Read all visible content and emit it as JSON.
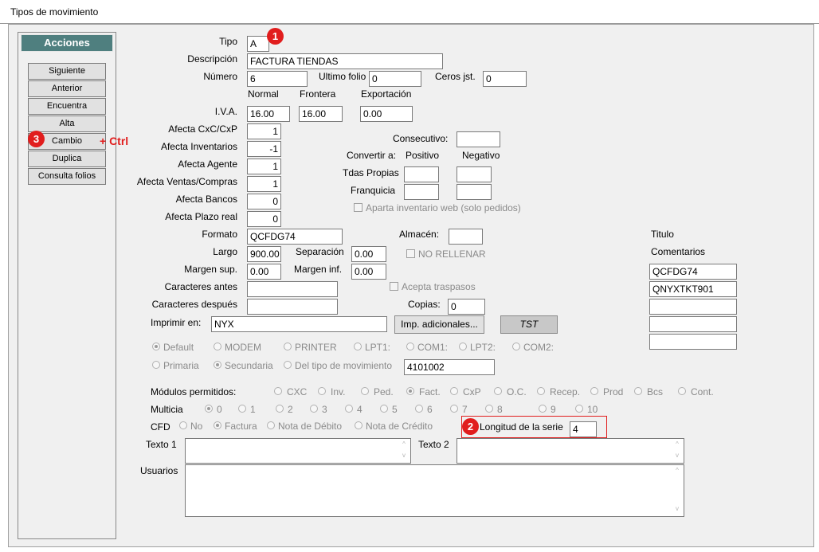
{
  "window": {
    "title": "Tipos de movimiento"
  },
  "acciones": {
    "title": "Acciones",
    "buttons": [
      "Siguiente",
      "Anterior",
      "Encuentra",
      "Alta",
      "Cambio",
      "Duplica",
      "Consulta folios"
    ]
  },
  "annotations": {
    "b1": "1",
    "b2": "2",
    "b3": "3",
    "ctrl": "+ Ctrl"
  },
  "form": {
    "tipo": {
      "label": "Tipo",
      "value": "A"
    },
    "descripcion": {
      "label": "Descripción",
      "value": "FACTURA TIENDAS"
    },
    "numero": {
      "label": "Número",
      "value": "6"
    },
    "ultimo_folio": {
      "label": "Ultimo folio",
      "value": "0"
    },
    "ceros_jst": {
      "label": "Ceros jst.",
      "value": "0"
    },
    "iva": {
      "label": "I.V.A.",
      "cols": [
        "Normal",
        "Frontera",
        "Exportación"
      ],
      "values": [
        "16.00",
        "16.00",
        "0.00"
      ]
    },
    "afecta": [
      {
        "label": "Afecta  CxC/CxP",
        "value": "1"
      },
      {
        "label": "Afecta  Inventarios",
        "value": "-1"
      },
      {
        "label": "Afecta  Agente",
        "value": "1"
      },
      {
        "label": "Afecta  Ventas/Compras",
        "value": "1"
      },
      {
        "label": "Afecta  Bancos",
        "value": "0"
      },
      {
        "label": "Afecta  Plazo real",
        "value": "0"
      }
    ],
    "consecutivo": {
      "label": "Consecutivo:",
      "value": ""
    },
    "convertir": {
      "label": "Convertir a:",
      "positivo": "Positivo",
      "negativo": "Negativo",
      "tdas": "Tdas Propias",
      "franquicia": "Franquicia"
    },
    "aparta": "Aparta inventario web (solo pedidos)",
    "formato": {
      "label": "Formato",
      "value": "QCFDG74"
    },
    "almacen": {
      "label": "Almacén:",
      "value": ""
    },
    "largo": {
      "label": "Largo",
      "value": "900.00"
    },
    "separacion": {
      "label": "Separación",
      "value": "0.00"
    },
    "no_rellenar": "NO RELLENAR",
    "margen_sup": {
      "label": "Margen sup.",
      "value": "0.00"
    },
    "margen_inf": {
      "label": "Margen inf.",
      "value": "0.00"
    },
    "car_antes": {
      "label": "Caracteres antes",
      "value": ""
    },
    "acepta": "Acepta traspasos",
    "car_despues": {
      "label": "Caracteres después",
      "value": ""
    },
    "copias": {
      "label": "Copias:",
      "value": "0"
    },
    "imprimir": {
      "label": "Imprimir en:",
      "value": "NYX"
    },
    "imp_btn": "Imp. adicionales...",
    "tst_btn": "TST",
    "titulo": "Titulo",
    "comentarios": {
      "label": "Comentarios",
      "values": [
        "QCFDG74",
        "QNYXTKT901",
        "",
        "",
        ""
      ]
    },
    "printers": [
      "Default",
      "MODEM",
      "PRINTER",
      "LPT1:",
      "COM1:",
      "LPT2:",
      "COM2:"
    ],
    "prim": [
      "Primaria",
      "Secundaria",
      "Del tipo de movimiento"
    ],
    "tipo_mov_value": "4101002",
    "modulos": {
      "label": "Módulos permitidos:",
      "items": [
        "CXC",
        "Inv.",
        "Ped.",
        "Fact.",
        "CxP",
        "O.C.",
        "Recep.",
        "Prod",
        "Bcs",
        "Cont."
      ]
    },
    "multicia": {
      "label": "Multicia",
      "items": [
        "0",
        "1",
        "2",
        "3",
        "4",
        "5",
        "6",
        "7",
        "8",
        "9",
        "10"
      ]
    },
    "cfd": {
      "label": "CFD",
      "items": [
        "No",
        "Factura",
        "Nota de Débito",
        "Nota de Crédito"
      ]
    },
    "longitud": {
      "label": "Longitud de la serie",
      "value": "4"
    },
    "texto1": "Texto 1",
    "texto2": "Texto 2",
    "usuarios": "Usuarios"
  },
  "colors": {
    "accent": "#4f7f7f",
    "badge": "#e11d1d"
  }
}
